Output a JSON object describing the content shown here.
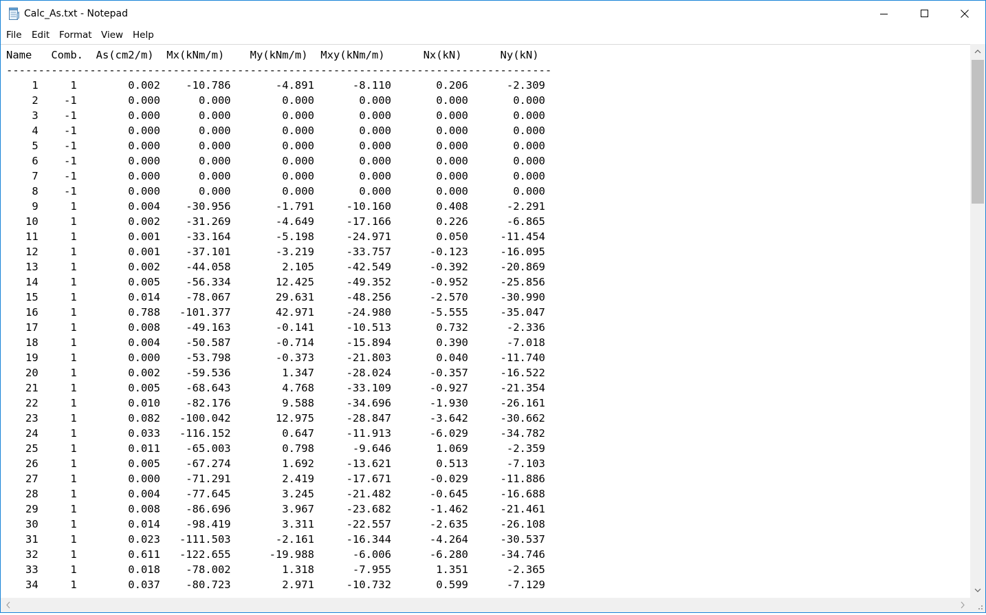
{
  "window": {
    "title": "Calc_As.txt - Notepad",
    "border_color": "#1883d7"
  },
  "menu": [
    {
      "label": "File"
    },
    {
      "label": "Edit"
    },
    {
      "label": "Format"
    },
    {
      "label": "View"
    },
    {
      "label": "Help"
    }
  ],
  "document": {
    "text": "Name   Comb.  As(cm2/m)  Mx(kNm/m)    My(kNm/m)  Mxy(kNm/m)      Nx(kN)      Ny(kN)\n-------------------------------------------------------------------------------------\n    1     1        0.002    -10.786       -4.891      -8.110       0.206      -2.309\n    2    -1        0.000      0.000        0.000       0.000       0.000       0.000\n    3    -1        0.000      0.000        0.000       0.000       0.000       0.000\n    4    -1        0.000      0.000        0.000       0.000       0.000       0.000\n    5    -1        0.000      0.000        0.000       0.000       0.000       0.000\n    6    -1        0.000      0.000        0.000       0.000       0.000       0.000\n    7    -1        0.000      0.000        0.000       0.000       0.000       0.000\n    8    -1        0.000      0.000        0.000       0.000       0.000       0.000\n    9     1        0.004    -30.956       -1.791     -10.160       0.408      -2.291\n   10     1        0.002    -31.269       -4.649     -17.166       0.226      -6.865\n   11     1        0.001    -33.164       -5.198     -24.971       0.050     -11.454\n   12     1        0.001    -37.101       -3.219     -33.757      -0.123     -16.095\n   13     1        0.002    -44.058        2.105     -42.549      -0.392     -20.869\n   14     1        0.005    -56.334       12.425     -49.352      -0.952     -25.856\n   15     1        0.014    -78.067       29.631     -48.256      -2.570     -30.990\n   16     1        0.788   -101.377       42.971     -24.980      -5.555     -35.047\n   17     1        0.008    -49.163       -0.141     -10.513       0.732      -2.336\n   18     1        0.004    -50.587       -0.714     -15.894       0.390      -7.018\n   19     1        0.000    -53.798       -0.373     -21.803       0.040     -11.740\n   20     1        0.002    -59.536        1.347     -28.024      -0.357     -16.522\n   21     1        0.005    -68.643        4.768     -33.109      -0.927     -21.354\n   22     1        0.010    -82.176        9.588     -34.696      -1.930     -26.161\n   23     1        0.082   -100.042       12.975     -28.847      -3.642     -30.662\n   24     1        0.033   -116.152        0.647     -11.913      -6.029     -34.782\n   25     1        0.011    -65.003        0.798      -9.646       1.069      -2.359\n   26     1        0.005    -67.274        1.692     -13.621       0.513      -7.103\n   27     1        0.000    -71.291        2.419     -17.671      -0.029     -11.886\n   28     1        0.004    -77.645        3.245     -21.482      -0.645     -16.688\n   29     1        0.008    -86.696        3.967     -23.682      -1.462     -21.461\n   30     1        0.014    -98.419        3.311     -22.557      -2.635     -26.108\n   31     1        0.023   -111.503       -2.161     -16.344      -4.264     -30.537\n   32     1        0.611   -122.655      -19.988      -6.006      -6.280     -34.746\n   33     1        0.018    -78.002        1.318      -7.955       1.351      -2.365\n   34     1        0.037    -80.723        2.971     -10.732       0.599      -7.129"
  },
  "icons": {
    "app": "notepad-icon",
    "minimize": "minimize-icon",
    "maximize": "maximize-icon",
    "close": "close-icon",
    "scroll_up": "chevron-up-icon",
    "scroll_down": "chevron-down-icon",
    "scroll_left": "chevron-left-icon",
    "scroll_right": "chevron-right-icon"
  }
}
